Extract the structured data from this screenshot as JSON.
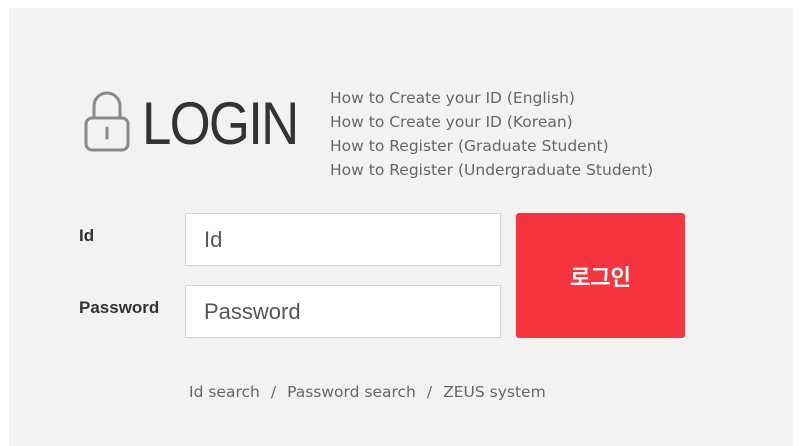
{
  "header": {
    "title": "LOGIN",
    "icon": "lock-icon"
  },
  "help_links": [
    "How to Create your ID (English)",
    "How to Create your ID (Korean)",
    "How to Register (Graduate Student)",
    "How to Register (Undergraduate Student)"
  ],
  "form": {
    "id_label": "Id",
    "id_placeholder": "Id",
    "id_value": "",
    "password_label": "Password",
    "password_placeholder": "Password",
    "password_value": "",
    "submit_label": "로그인"
  },
  "footer_links": {
    "id_search": "Id search",
    "password_search": "Password search",
    "zeus_system": "ZEUS system",
    "separator": "/"
  },
  "colors": {
    "accent": "#f4353f",
    "panel_background": "#f2f2f2",
    "text": "#333333",
    "muted_text": "#666666"
  }
}
